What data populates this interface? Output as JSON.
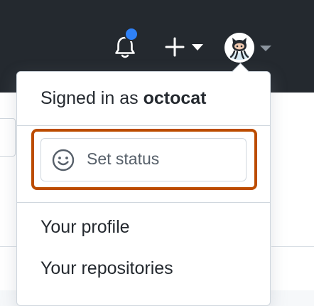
{
  "header": {
    "notifications_icon": "bell-icon",
    "unread_indicator_color": "#2f81f7",
    "create_icon": "plus-icon",
    "avatar_icon": "octocat-avatar"
  },
  "user_menu": {
    "signed_in_prefix": "Signed in as",
    "username": "octocat",
    "set_status": {
      "icon": "smiley-icon",
      "label": "Set status",
      "highlight_color": "#bc4c00"
    },
    "items": [
      {
        "label": "Your profile"
      },
      {
        "label": "Your repositories"
      }
    ]
  }
}
